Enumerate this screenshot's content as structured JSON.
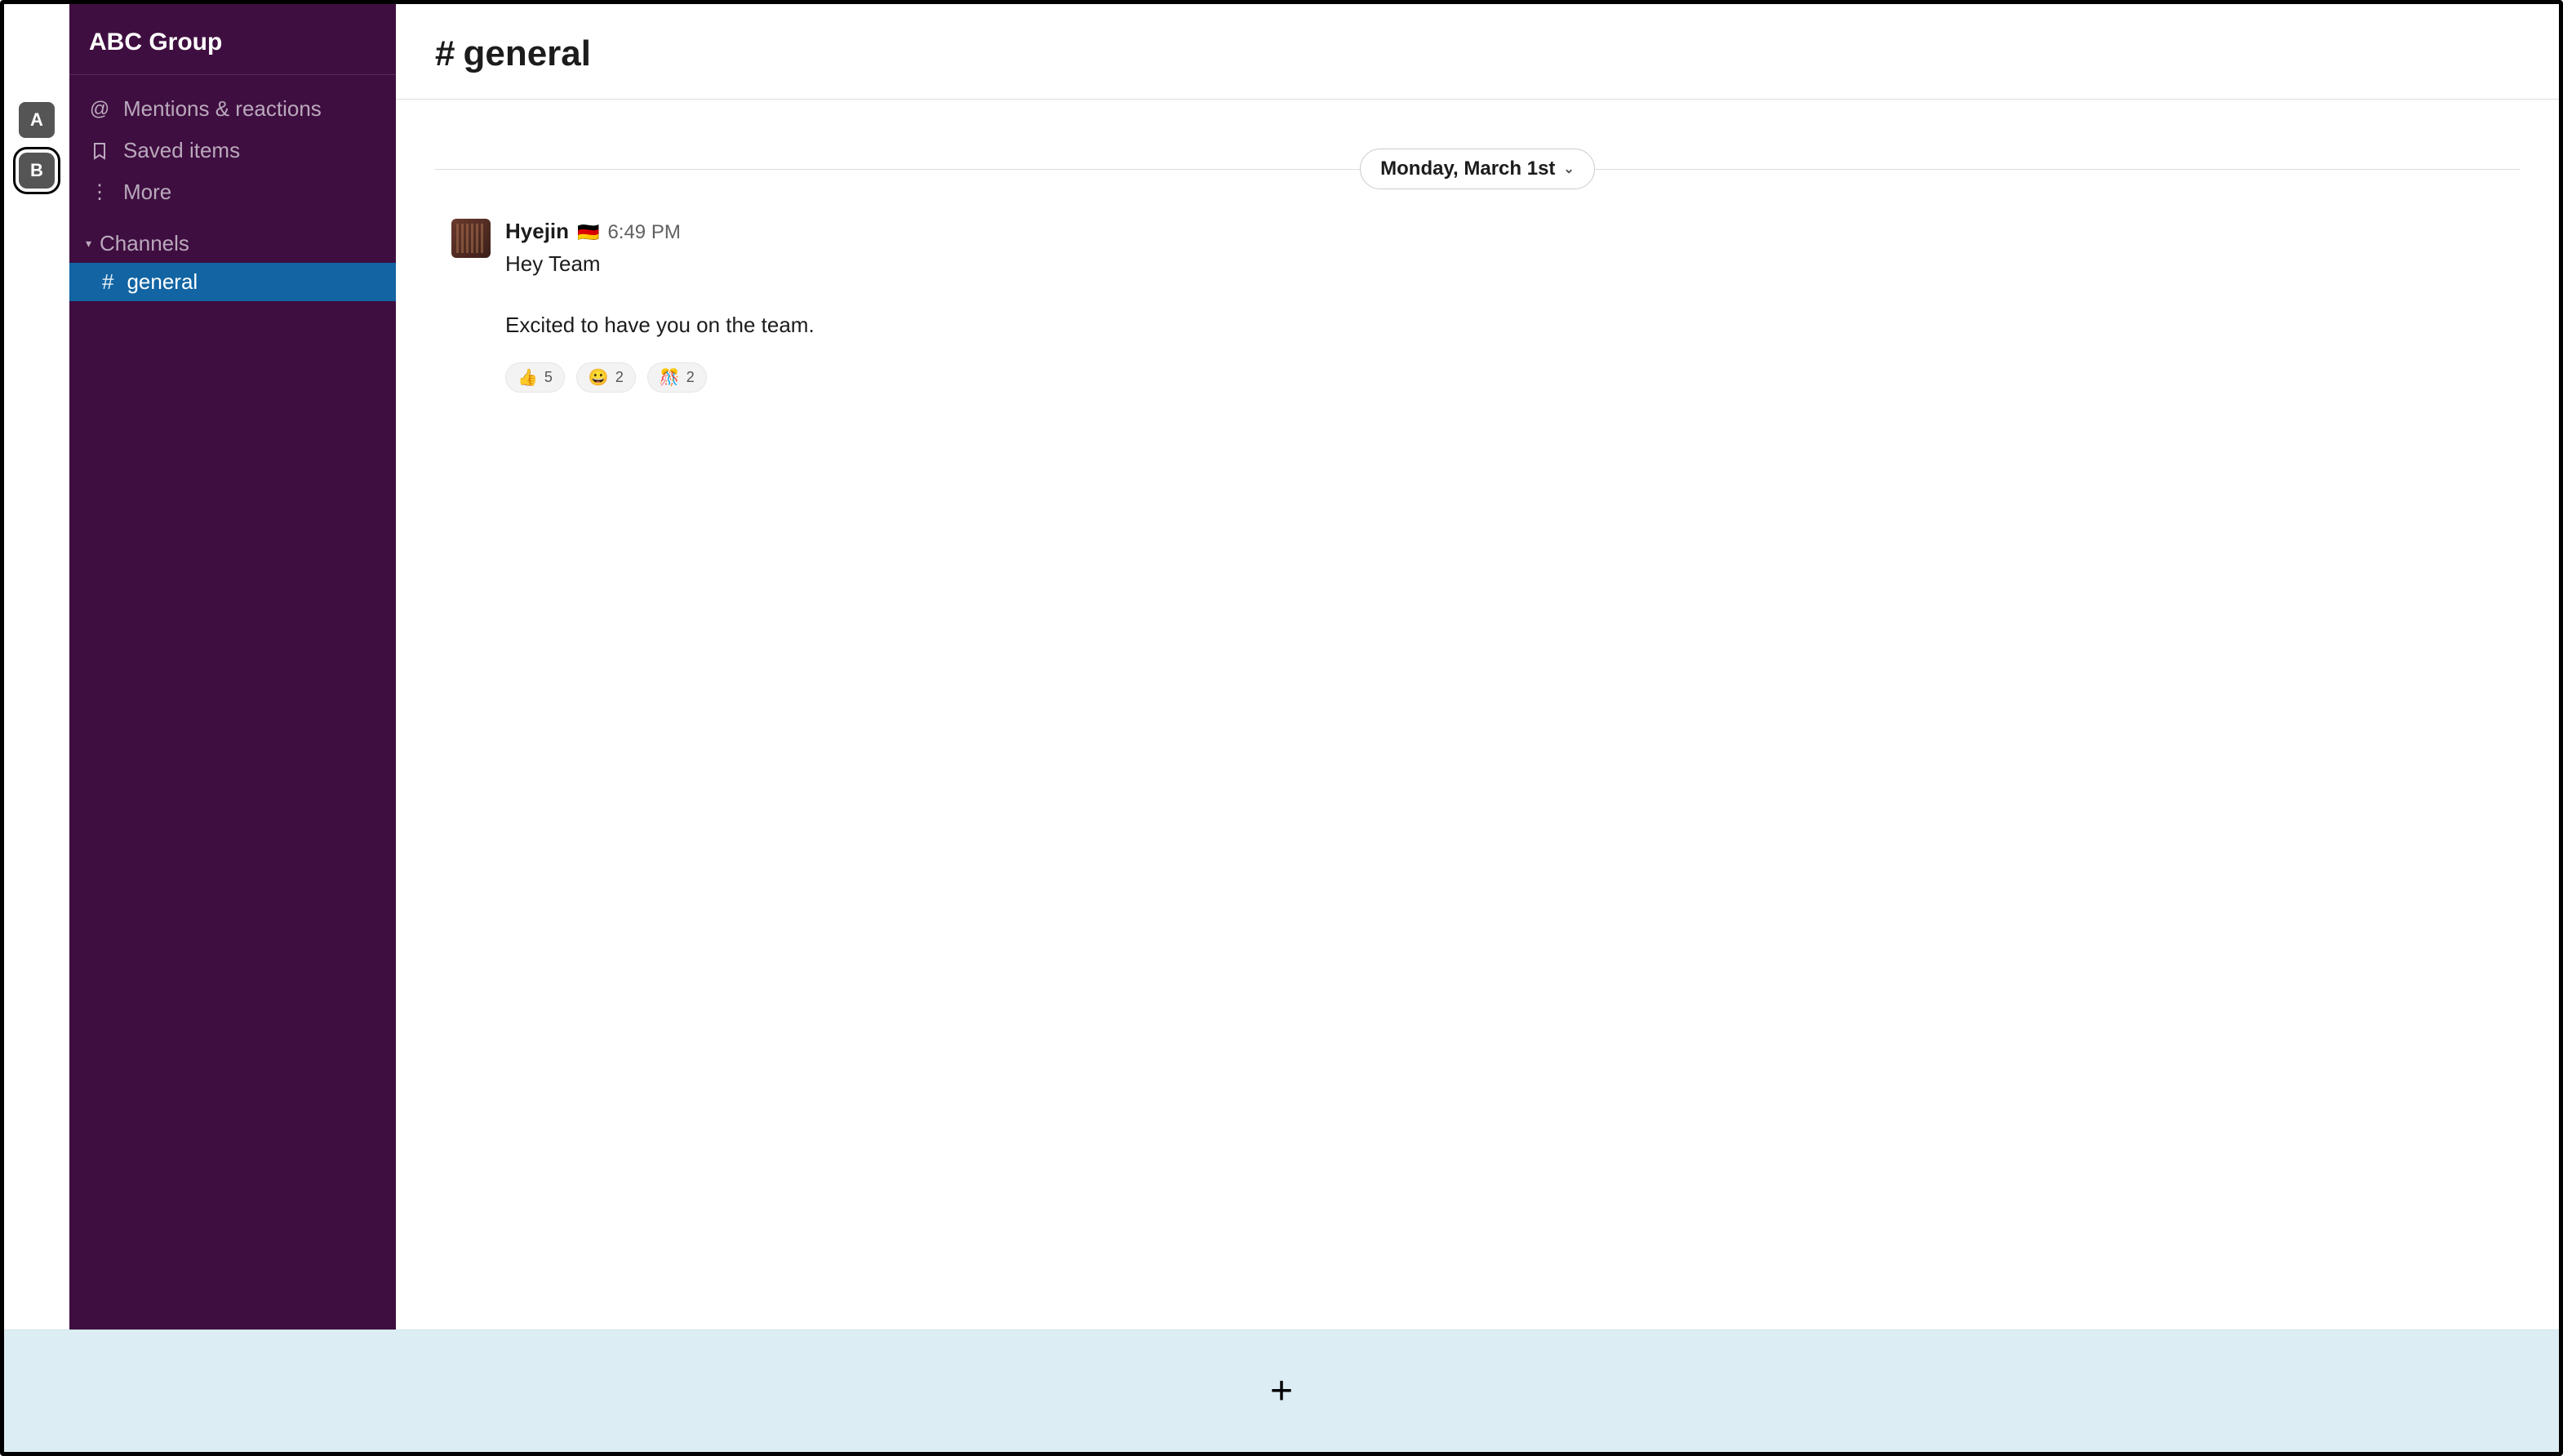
{
  "workspace_rail": {
    "items": [
      {
        "letter": "A",
        "active": false
      },
      {
        "letter": "B",
        "active": true
      }
    ]
  },
  "sidebar": {
    "workspace_name": "ABC Group",
    "nav": {
      "mentions_label": "Mentions & reactions",
      "saved_label": "Saved items",
      "more_label": "More"
    },
    "channels_header": "Channels",
    "channels": [
      {
        "name": "general",
        "active": true
      }
    ]
  },
  "main": {
    "channel_hash": "#",
    "channel_name": "general",
    "date_label": "Monday, March 1st",
    "message": {
      "author": "Hyejin",
      "flag": "🇩🇪",
      "time": "6:49 PM",
      "text": "Hey Team\n\nExcited to have you on the team.",
      "reactions": [
        {
          "emoji": "👍",
          "count": 5
        },
        {
          "emoji": "😀",
          "count": 2
        },
        {
          "emoji": "🎊",
          "count": 2
        }
      ]
    }
  },
  "compose": {
    "plus": "+"
  }
}
